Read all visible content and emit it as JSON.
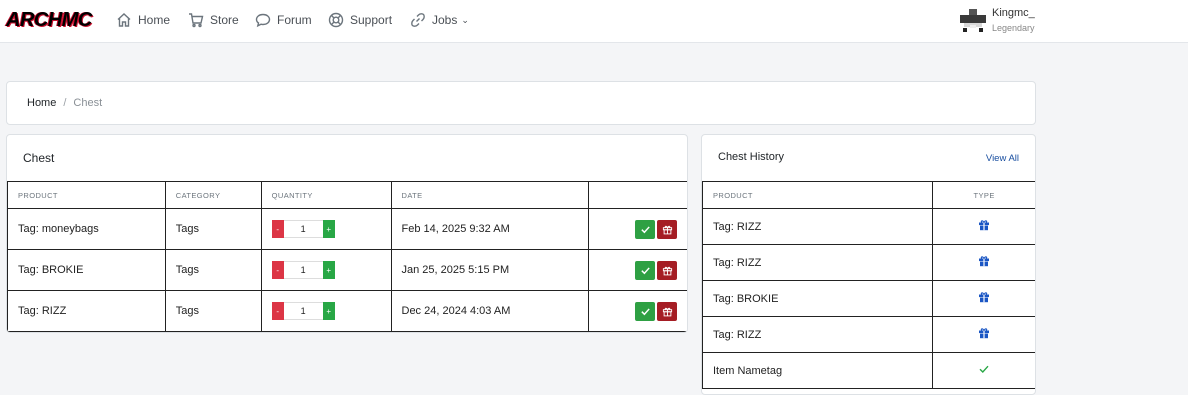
{
  "nav": {
    "logo": "ARCHMC",
    "items": [
      {
        "label": "Home",
        "icon": "home-icon"
      },
      {
        "label": "Store",
        "icon": "cart-icon"
      },
      {
        "label": "Forum",
        "icon": "chat-icon"
      },
      {
        "label": "Support",
        "icon": "lifebuoy-icon"
      },
      {
        "label": "Jobs",
        "icon": "link-icon"
      }
    ],
    "user": {
      "name": "Kingmc_",
      "rank": "Legendary"
    }
  },
  "breadcrumb": {
    "home": "Home",
    "separator": "/",
    "current": "Chest"
  },
  "chest": {
    "title": "Chest",
    "columns": [
      "PRODUCT",
      "CATEGORY",
      "QUANTITY",
      "DATE",
      ""
    ],
    "qty_minus": "-",
    "qty_plus": "+",
    "rows": [
      {
        "product": "Tag: moneybags",
        "category": "Tags",
        "quantity": "1",
        "date": "Feb 14, 2025 9:32 AM"
      },
      {
        "product": "Tag: BROKIE",
        "category": "Tags",
        "quantity": "1",
        "date": "Jan 25, 2025 5:15 PM"
      },
      {
        "product": "Tag: RIZZ",
        "category": "Tags",
        "quantity": "1",
        "date": "Dec 24, 2024 4:03 AM"
      }
    ]
  },
  "history": {
    "title": "Chest History",
    "view_all": "View All",
    "columns": [
      "PRODUCT",
      "TYPE"
    ],
    "rows": [
      {
        "product": "Tag: RIZZ",
        "type": "gift-icon"
      },
      {
        "product": "Tag: RIZZ",
        "type": "gift-icon"
      },
      {
        "product": "Tag: BROKIE",
        "type": "gift-icon"
      },
      {
        "product": "Tag: RIZZ",
        "type": "gift-icon"
      },
      {
        "product": "Item Nametag",
        "type": "check-icon"
      }
    ]
  },
  "colors": {
    "accept": "#2ea043",
    "gift_button": "#a51d24",
    "gift_icon": "#1a56c4",
    "check_icon": "#28a745",
    "minus": "#dc3545",
    "plus": "#28a745"
  }
}
